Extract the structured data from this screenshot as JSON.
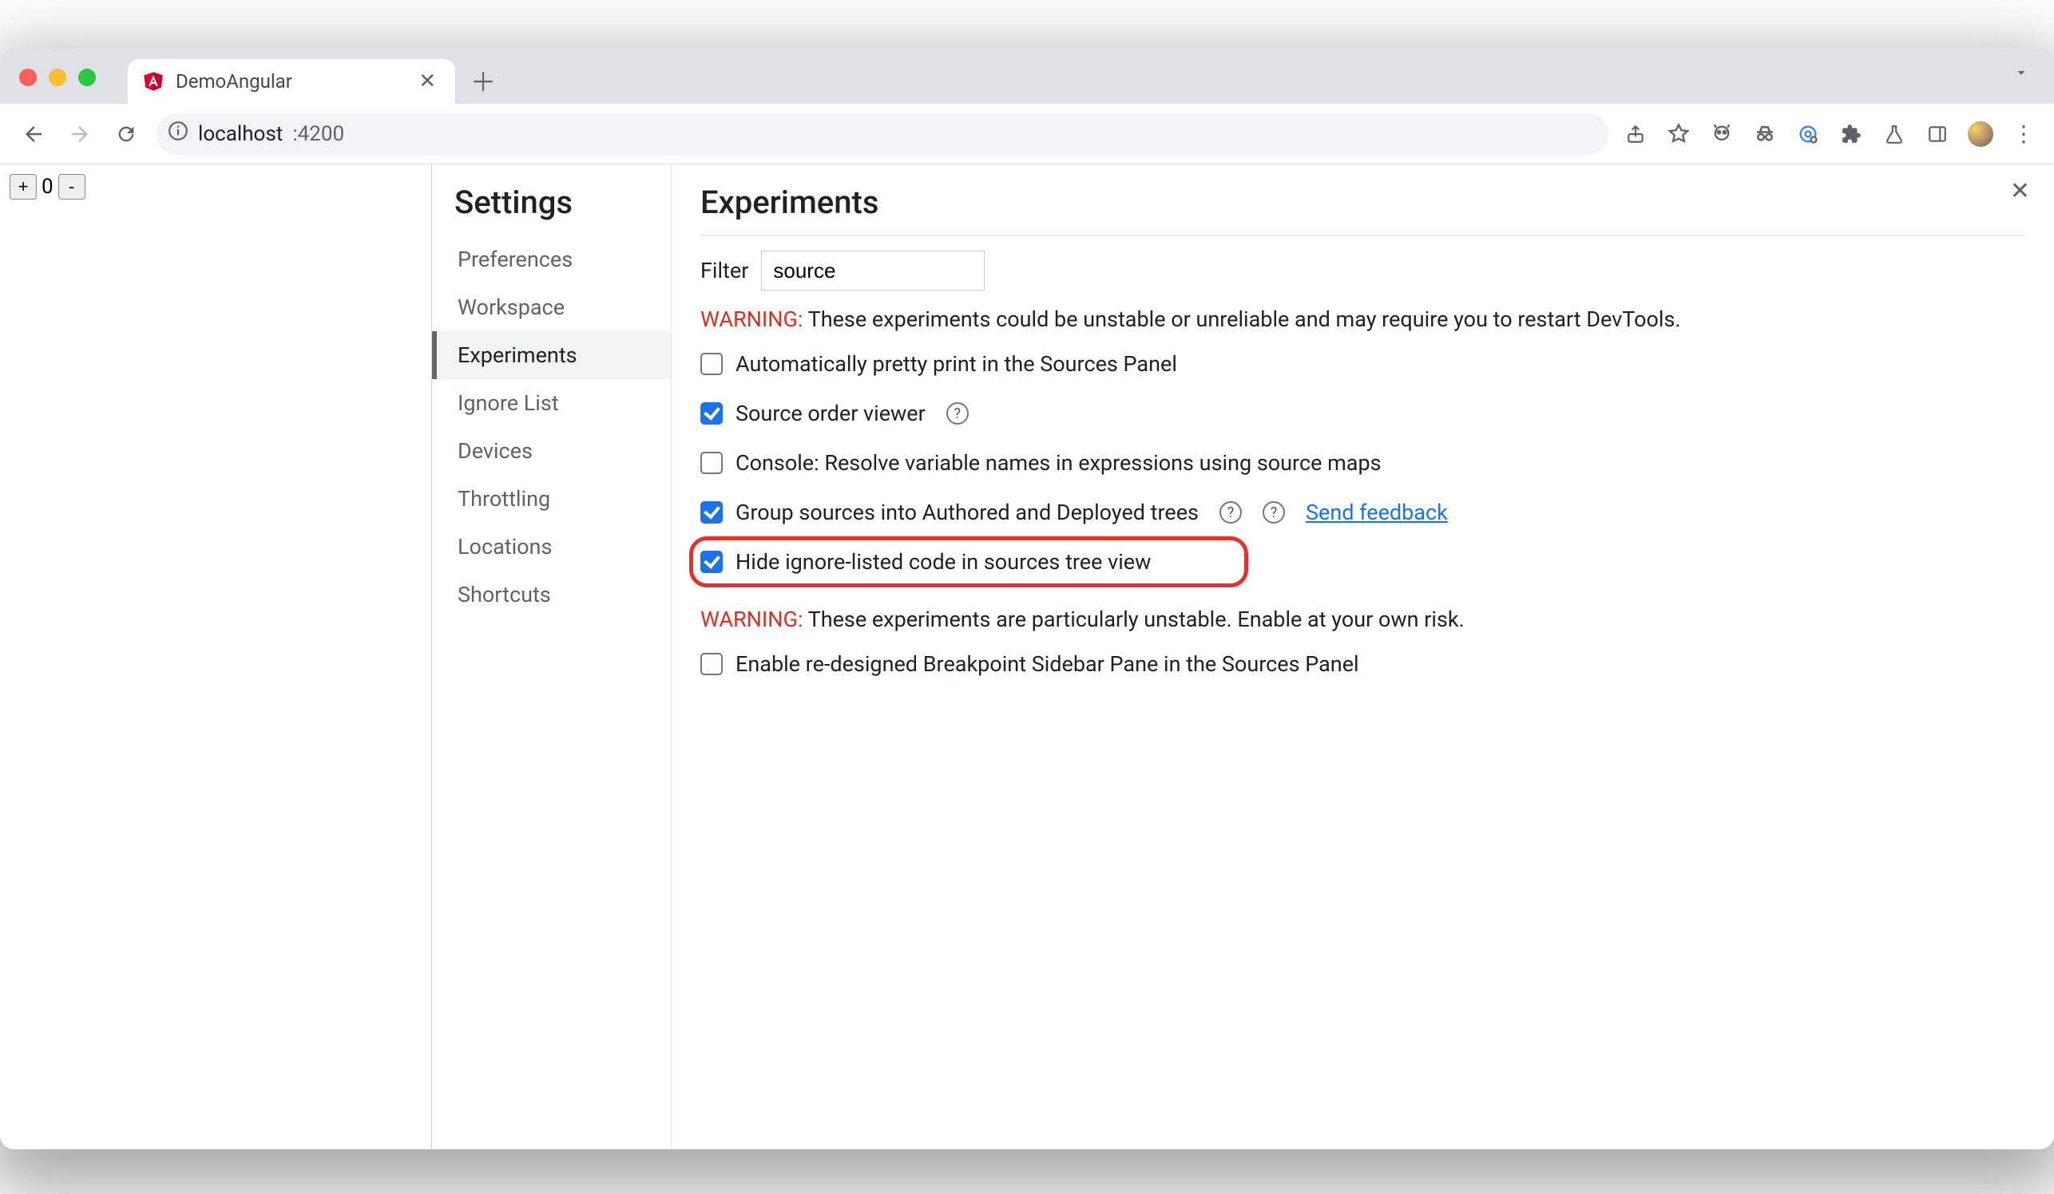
{
  "tab": {
    "title": "DemoAngular"
  },
  "url": {
    "host": "localhost",
    "port": ":4200"
  },
  "counter": {
    "plus": "+",
    "value": "0",
    "minus": "-"
  },
  "settings": {
    "title": "Settings",
    "nav": [
      {
        "label": "Preferences",
        "active": false
      },
      {
        "label": "Workspace",
        "active": false
      },
      {
        "label": "Experiments",
        "active": true
      },
      {
        "label": "Ignore List",
        "active": false
      },
      {
        "label": "Devices",
        "active": false
      },
      {
        "label": "Throttling",
        "active": false
      },
      {
        "label": "Locations",
        "active": false
      },
      {
        "label": "Shortcuts",
        "active": false
      }
    ]
  },
  "experiments": {
    "title": "Experiments",
    "filter_label": "Filter",
    "filter_value": "source",
    "warning1_prefix": "WARNING:",
    "warning1_text": " These experiments could be unstable or unreliable and may require you to restart DevTools.",
    "items": [
      {
        "label": "Automatically pretty print in the Sources Panel",
        "checked": false,
        "help": false,
        "feedback": false,
        "highlight": false
      },
      {
        "label": "Source order viewer",
        "checked": true,
        "help": true,
        "feedback": false,
        "highlight": false
      },
      {
        "label": "Console: Resolve variable names in expressions using source maps",
        "checked": false,
        "help": false,
        "feedback": false,
        "highlight": false
      },
      {
        "label": "Group sources into Authored and Deployed trees",
        "checked": true,
        "help": true,
        "feedback": true,
        "highlight": false
      },
      {
        "label": "Hide ignore-listed code in sources tree view",
        "checked": true,
        "help": false,
        "feedback": false,
        "highlight": true
      }
    ],
    "feedback_label": "Send feedback",
    "warning2_prefix": "WARNING:",
    "warning2_text": " These experiments are particularly unstable. Enable at your own risk.",
    "items2": [
      {
        "label": "Enable re-designed Breakpoint Sidebar Pane in the Sources Panel",
        "checked": false
      }
    ]
  }
}
